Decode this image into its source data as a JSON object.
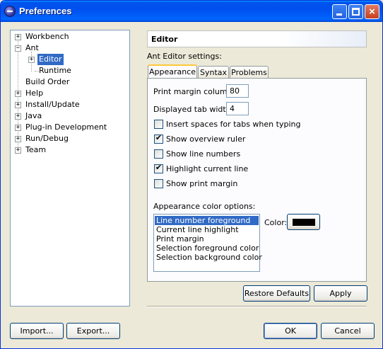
{
  "window": {
    "title": "Preferences",
    "close_glyph": "×"
  },
  "tree": {
    "items": [
      {
        "label": "Workbench",
        "expander": "+"
      },
      {
        "label": "Ant",
        "expander": "−"
      },
      {
        "label": "Editor",
        "expander": "+"
      },
      {
        "label": "Runtime",
        "expander": ""
      },
      {
        "label": "Build Order",
        "expander": ""
      },
      {
        "label": "Help",
        "expander": "+"
      },
      {
        "label": "Install/Update",
        "expander": "+"
      },
      {
        "label": "Java",
        "expander": "+"
      },
      {
        "label": "Plug-in Development",
        "expander": "+"
      },
      {
        "label": "Run/Debug",
        "expander": "+"
      },
      {
        "label": "Team",
        "expander": "+"
      }
    ],
    "selected": "Editor"
  },
  "page": {
    "header": "Editor",
    "description": "Ant Editor settings:"
  },
  "tabs": [
    {
      "label": "Appearance",
      "active": true
    },
    {
      "label": "Syntax",
      "active": false
    },
    {
      "label": "Problems",
      "active": false
    }
  ],
  "appearance": {
    "print_margin_label": "Print margin column:",
    "print_margin_value": "80",
    "tab_width_label": "Displayed tab width:",
    "tab_width_value": "4",
    "checkboxes": [
      {
        "label": "Insert spaces for tabs when typing",
        "checked": false
      },
      {
        "label": "Show overview ruler",
        "checked": true
      },
      {
        "label": "Show line numbers",
        "checked": false
      },
      {
        "label": "Highlight current line",
        "checked": true
      },
      {
        "label": "Show print margin",
        "checked": false
      }
    ],
    "color_options_label": "Appearance color options:",
    "color_options": [
      "Line number foreground",
      "Current line highlight",
      "Print margin",
      "Selection foreground color",
      "Selection background color"
    ],
    "selected_color_option": "Line number foreground",
    "color_label": "Color:",
    "current_color": "#000000"
  },
  "buttons": {
    "restore_defaults": "Restore Defaults",
    "apply": "Apply",
    "import": "Import...",
    "export": "Export...",
    "ok": "OK",
    "cancel": "Cancel"
  },
  "colors": {
    "titlebar": "#0054e3",
    "selection": "#316ac5",
    "dialog_bg": "#ece9d8"
  },
  "icons": {
    "app": "eclipse-icon",
    "minimize": "minimize-icon",
    "maximize": "maximize-icon",
    "close": "close-icon"
  }
}
